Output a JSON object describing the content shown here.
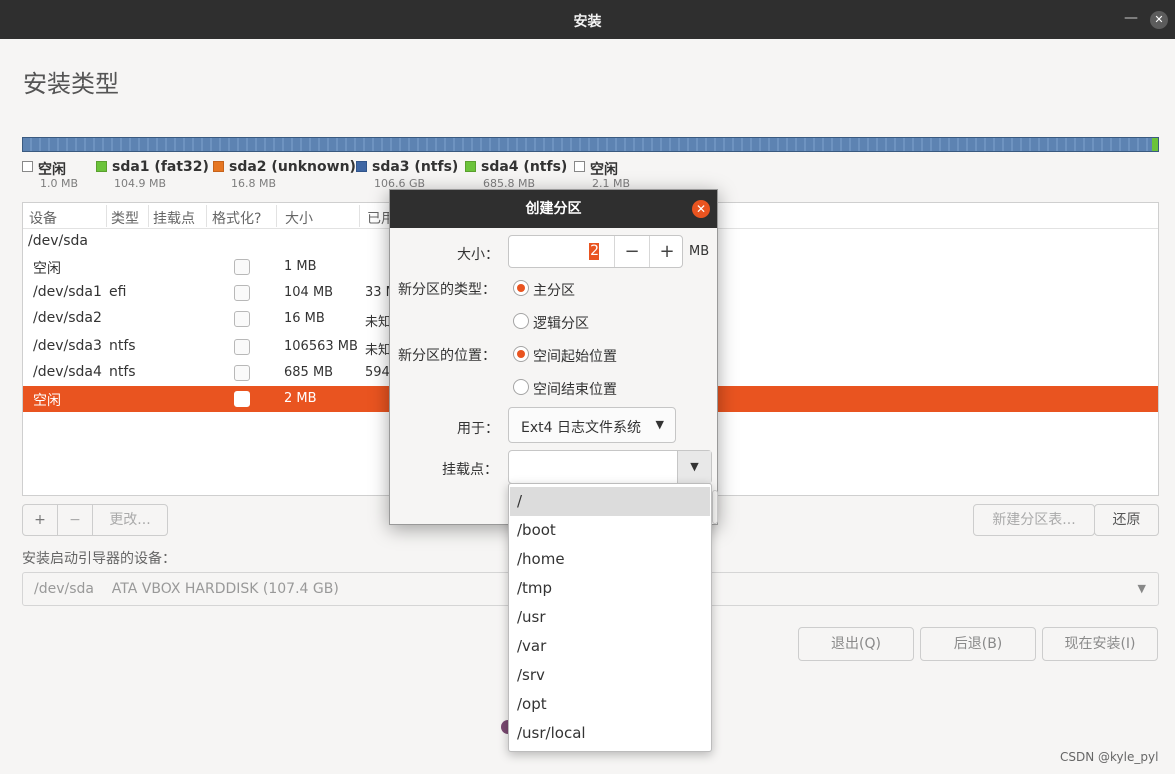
{
  "window": {
    "title": "安装"
  },
  "page": {
    "heading": "安装类型"
  },
  "legend": [
    {
      "name": "空闲",
      "size": "1.0 MB",
      "color": "#ffffff"
    },
    {
      "name": "sda1 (fat32)",
      "size": "104.9 MB",
      "color": "#6bc33a"
    },
    {
      "name": "sda2 (unknown)",
      "size": "16.8 MB",
      "color": "#e67622"
    },
    {
      "name": "sda3 (ntfs)",
      "size": "106.6 GB",
      "color": "#3e66a3"
    },
    {
      "name": "sda4 (ntfs)",
      "size": "685.8 MB",
      "color": "#6bc33a"
    },
    {
      "name": "空闲",
      "size": "2.1 MB",
      "color": "#ffffff"
    }
  ],
  "table": {
    "columns": [
      "设备",
      "类型",
      "挂载点",
      "格式化?",
      "大小",
      "已用"
    ],
    "group": "/dev/sda",
    "rows": [
      {
        "device": "空闲",
        "type": "",
        "size": "1 MB",
        "used": ""
      },
      {
        "device": "/dev/sda1",
        "type": "efi",
        "size": "104 MB",
        "used": "33 M"
      },
      {
        "device": "/dev/sda2",
        "type": "",
        "size": "16 MB",
        "used": "未知"
      },
      {
        "device": "/dev/sda3",
        "type": "ntfs",
        "size": "106563 MB",
        "used": "未知"
      },
      {
        "device": "/dev/sda4",
        "type": "ntfs",
        "size": "685 MB",
        "used": "594"
      },
      {
        "device": "空闲",
        "type": "",
        "size": "2 MB",
        "used": ""
      }
    ]
  },
  "table_buttons": {
    "add": "+",
    "remove": "−",
    "change": "更改...",
    "new_table": "新建分区表...",
    "revert": "还原"
  },
  "bootloader": {
    "label": "安装启动引导器的设备：",
    "value": "/dev/sda    ATA VBOX HARDDISK (107.4 GB)"
  },
  "footer_buttons": {
    "quit": "退出(Q)",
    "back": "后退(B)",
    "install": "现在安装(I)"
  },
  "dialog": {
    "title": "创建分区",
    "size_label": "大小：",
    "size_value": "2",
    "size_unit": "MB",
    "minus": "−",
    "plus": "+",
    "type_label": "新分区的类型：",
    "type_primary": "主分区",
    "type_logical": "逻辑分区",
    "location_label": "新分区的位置：",
    "location_start": "空间起始位置",
    "location_end": "空间结束位置",
    "use_label": "用于：",
    "use_value": "Ext4 日志文件系统",
    "mount_label": "挂载点：",
    "mount_value": ""
  },
  "mount_options": [
    "/",
    "/boot",
    "/home",
    "/tmp",
    "/usr",
    "/var",
    "/srv",
    "/opt",
    "/usr/local"
  ],
  "watermark": "CSDN @kyle_pyl",
  "icons": {
    "close": "close-icon",
    "minimize": "minimize-icon",
    "dropdown": "chevron-down-icon"
  }
}
